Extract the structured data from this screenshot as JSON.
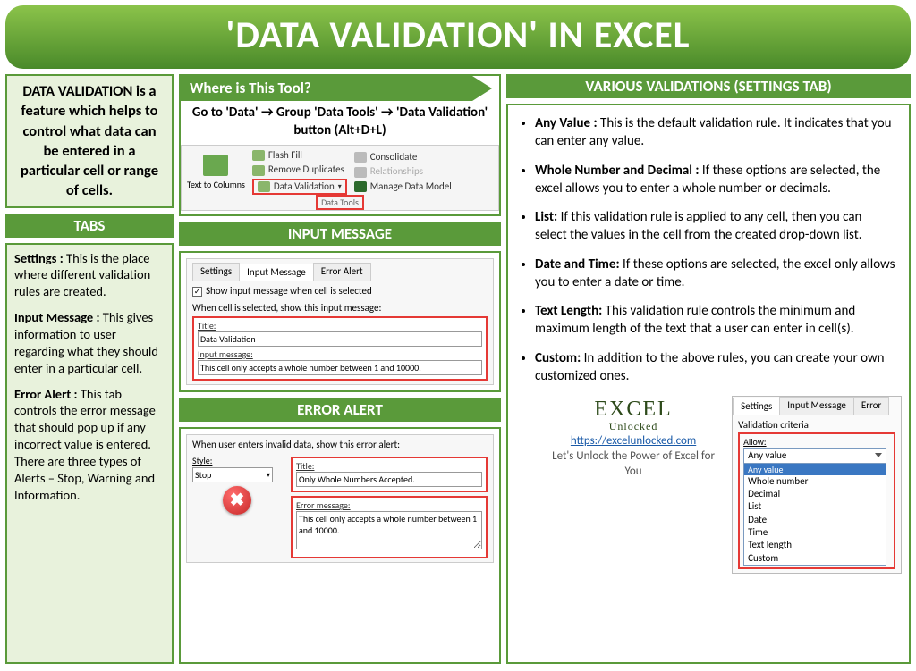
{
  "title": "'DATA VALIDATION' IN EXCEL",
  "intro": "DATA VALIDATION is a feature which helps to control what data can be entered in a particular cell or range of cells.",
  "tabs_head": "TABS",
  "tabs": {
    "settings_label": "Settings : ",
    "settings_text": "This is the place where different validation rules are created.",
    "input_label": "Input Message : ",
    "input_text": "This gives information to user regarding what they should enter in a particular cell.",
    "error_label": "Error Alert : ",
    "error_text": "This tab controls the error message that should pop up if any incorrect value is entered. There are three types of Alerts – Stop, Warning and Information."
  },
  "where_head": "Where is This Tool?",
  "where_instr": "Go to 'Data' → Group 'Data Tools' → 'Data Validation' button (Alt+D+L)",
  "ribbon": {
    "text_to_columns": "Text to Columns",
    "flash_fill": "Flash Fill",
    "remove_dupes": "Remove Duplicates",
    "data_validation": "Data Validation",
    "consolidate": "Consolidate",
    "relationships": "Relationships",
    "manage_model": "Manage Data Model",
    "group": "Data Tools"
  },
  "input_head": "INPUT MESSAGE",
  "input_dialog": {
    "tab_settings": "Settings",
    "tab_input": "Input Message",
    "tab_error": "Error Alert",
    "chk_label": "Show input message when cell is selected",
    "when_label": "When cell is selected, show this input message:",
    "title_label": "Title:",
    "title_value": "Data Validation",
    "msg_label": "Input message:",
    "msg_value": "This cell only accepts a whole number between 1 and 10000."
  },
  "error_head": "ERROR ALERT",
  "error_dialog": {
    "when_label": "When user enters invalid data, show this error alert:",
    "style_label": "Style:",
    "style_value": "Stop",
    "title_label": "Title:",
    "title_value": "Only Whole Numbers Accepted.",
    "msg_label": "Error message:",
    "msg_value": "This cell only accepts a whole number between 1 and 10000."
  },
  "valid_head": "VARIOUS VALIDATIONS (SETTINGS TAB)",
  "validations": [
    {
      "k": "Any Value : ",
      "v": " This is the default validation rule. It indicates that you can enter any value."
    },
    {
      "k": "Whole Number and Decimal : ",
      "v": "If these options are selected, the excel allows you to enter a whole number or decimals."
    },
    {
      "k": "List: ",
      "v": "If this validation rule is applied to any cell, then you can select the values in the cell from the created drop-down list."
    },
    {
      "k": "Date and Time: ",
      "v": "If these options are selected, the excel only allows you to enter a date or time."
    },
    {
      "k": "Text Length: ",
      "v": "This validation rule controls the minimum and maximum length of the text that a user can enter in cell(s)."
    },
    {
      "k": "Custom: ",
      "v": "In addition to the above rules, you can create your own customized ones."
    }
  ],
  "brand": {
    "name_top": "EXCEL",
    "name_bottom": "Unlocked",
    "url": "https://excelunlocked.com",
    "tagline": "Let's Unlock the Power of Excel for You"
  },
  "settings_panel": {
    "tab_settings": "Settings",
    "tab_input": "Input Message",
    "tab_error": "Error",
    "criteria": "Validation criteria",
    "allow": "Allow:",
    "selected": "Any value",
    "options": [
      "Any value",
      "Whole number",
      "Decimal",
      "List",
      "Date",
      "Time",
      "Text length",
      "Custom"
    ]
  }
}
